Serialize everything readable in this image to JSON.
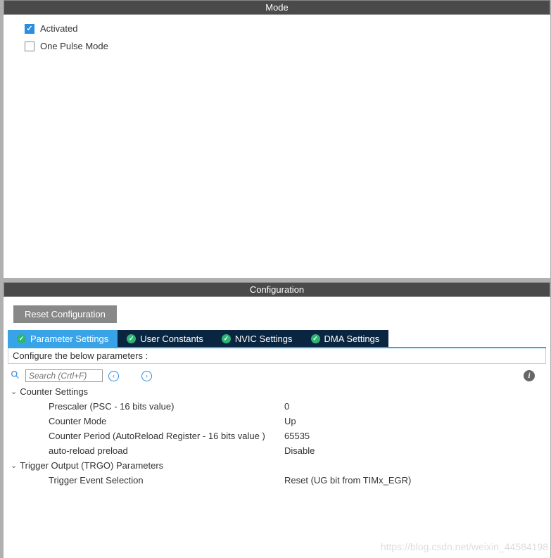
{
  "mode": {
    "header": "Mode",
    "activated": {
      "label": "Activated",
      "checked": true
    },
    "onePulse": {
      "label": "One Pulse Mode",
      "checked": false
    }
  },
  "config": {
    "header": "Configuration",
    "resetLabel": "Reset Configuration",
    "tabs": [
      {
        "label": "Parameter Settings",
        "active": true
      },
      {
        "label": "User Constants",
        "active": false
      },
      {
        "label": "NVIC Settings",
        "active": false
      },
      {
        "label": "DMA Settings",
        "active": false
      }
    ],
    "hint": "Configure the below parameters :",
    "searchPlaceholder": "Search (Crtl+F)",
    "groups": [
      {
        "title": "Counter Settings",
        "items": [
          {
            "label": "Prescaler (PSC - 16 bits value)",
            "value": "0"
          },
          {
            "label": "Counter Mode",
            "value": "Up"
          },
          {
            "label": "Counter Period (AutoReload Register - 16 bits value )",
            "value": "65535"
          },
          {
            "label": "auto-reload preload",
            "value": "Disable"
          }
        ]
      },
      {
        "title": "Trigger Output (TRGO) Parameters",
        "items": [
          {
            "label": "Trigger Event Selection",
            "value": "Reset (UG bit from TIMx_EGR)"
          }
        ]
      }
    ]
  },
  "watermark": "https://blog.csdn.net/weixin_44584198"
}
